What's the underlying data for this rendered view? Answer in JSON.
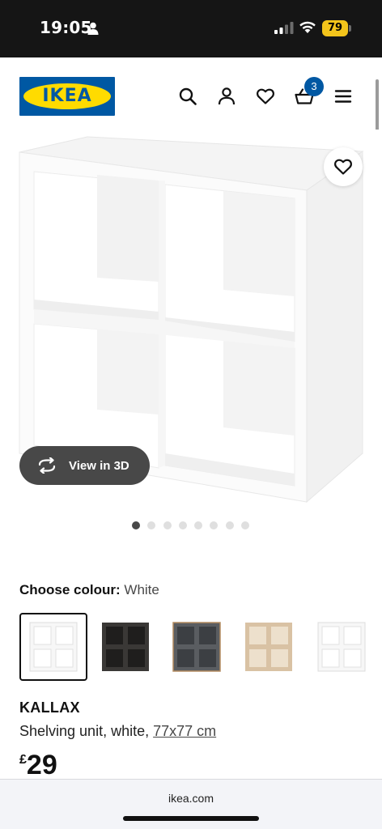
{
  "status_bar": {
    "time": "19:05",
    "battery": "79"
  },
  "header": {
    "logo_text": "IKEA",
    "cart_count": "3",
    "icons": [
      "search-icon",
      "account-icon",
      "heart-icon",
      "basket-icon",
      "menu-icon"
    ],
    "brand_blue": "#0058a3",
    "brand_yellow": "#ffdb00"
  },
  "gallery": {
    "view_3d_label": "View in 3D",
    "image_count": 8,
    "active_index": 0
  },
  "colour": {
    "label": "Choose colour:",
    "selected_value": "White",
    "swatches": [
      {
        "name": "White",
        "frame": "#f7f7f7",
        "selected": true
      },
      {
        "name": "Black-brown",
        "frame": "#3a3836",
        "selected": false
      },
      {
        "name": "Dark grey/wood",
        "frame": "#5a5d61",
        "selected": false
      },
      {
        "name": "White stained oak effect",
        "frame": "#d9c2a4",
        "selected": false
      },
      {
        "name": "White",
        "frame": "#f7f7f7",
        "selected": false
      }
    ]
  },
  "product": {
    "name": "KALLAX",
    "description": "Shelving unit, white,",
    "dimensions": "77x77 cm",
    "currency": "£",
    "price": "29"
  },
  "browser": {
    "url": "ikea.com"
  }
}
